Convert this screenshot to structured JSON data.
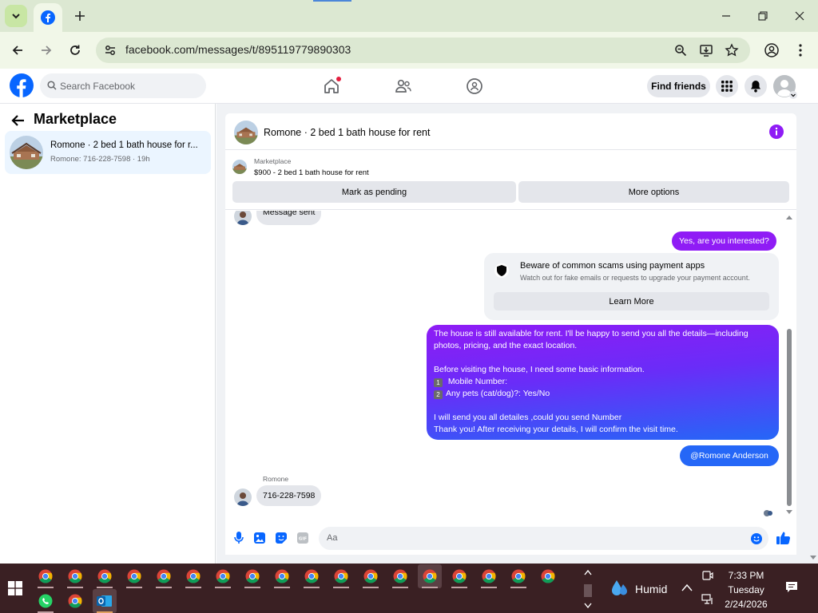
{
  "browser": {
    "url": "facebook.com/messages/t/895119779890303"
  },
  "facebook": {
    "search_placeholder": "Search Facebook",
    "find_friends": "Find friends"
  },
  "left_panel": {
    "title": "Marketplace",
    "conversation": {
      "title": "Romone · 2 bed 1 bath house for r...",
      "subtitle": "Romone: 716-228-7598 · 19h"
    }
  },
  "chat": {
    "header_title": "Romone · 2 bed 1 bath house for rent",
    "listing": {
      "label": "Marketplace",
      "price_title": "$900 - 2 bed 1 bath house for rent"
    },
    "buttons": {
      "mark_pending": "Mark as pending",
      "more_options": "More options"
    },
    "messages": {
      "partial_incoming": "Message sent",
      "outgoing_question": "Yes, are you interested?",
      "scam_notice": {
        "title": "Beware of common scams using payment apps",
        "subtitle": "Watch out for fake emails or requests to upgrade your payment account.",
        "button": "Learn More"
      },
      "long_message": {
        "line1": "The house is still available for rent. I'll be happy to send you all the details—including",
        "line2": "photos, pricing, and the exact location.",
        "line3": "Before visiting the house, I need some basic information.",
        "item1_num": "1",
        "item1": " Mobile Number:",
        "item2_num": "2",
        "item2": "Any pets (cat/dog)?: Yes/No",
        "line4": "I will send you all detailes ,could you send Number",
        "line5": "Thank you! After receiving your details, I will confirm the visit time."
      },
      "mention": "@Romone Anderson",
      "sender_name": "Romone",
      "incoming_number": "716-228-7598"
    },
    "composer": {
      "placeholder": "Aa"
    }
  },
  "taskbar": {
    "weather": "Humid",
    "time": "7:33 PM",
    "day": "Tuesday",
    "date": "2/24/2026"
  },
  "colors": {
    "facebook_blue": "#0866ff",
    "messenger_purple": "#8f1cf5",
    "messenger_blue": "#2567f7",
    "browser_green": "#dce8d2",
    "taskbar": "#3a2023"
  }
}
